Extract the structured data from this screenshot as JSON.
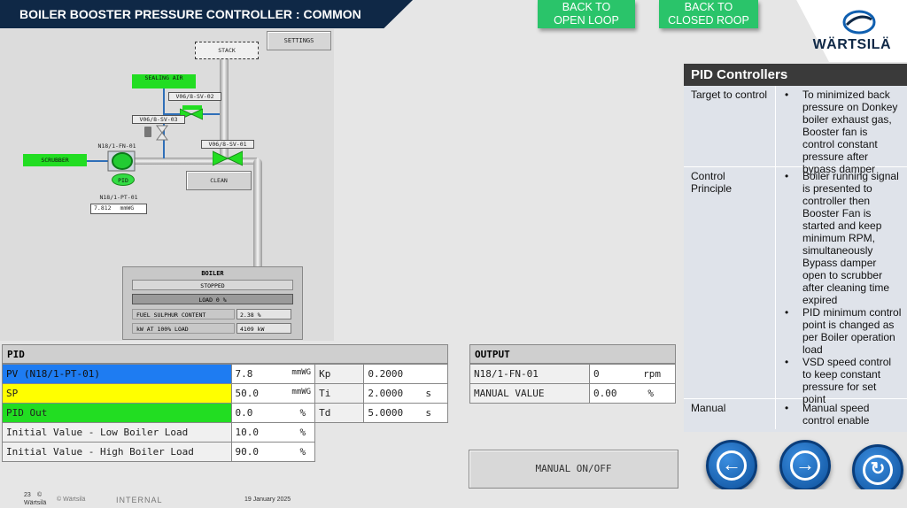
{
  "header": {
    "title": "BOILER BOOSTER PRESSURE CONTROLLER : COMMON",
    "back_open_loop": "BACK TO OPEN LOOP",
    "back_closed_loop": "BACK TO CLOSED ROOP",
    "logo": "WÄRTSILÄ"
  },
  "diagram": {
    "settings": "SETTINGS",
    "stack": "STACK",
    "sealing_air": "SEALING AIR",
    "valve_sv02": "V06/8-SV-02",
    "valve_sv03": "V06/8-SV-03",
    "valve_sv01": "V06/8-SV-01",
    "fan_tag": "N18/1-FN-01",
    "scrubber": "SCRUBBER",
    "pid": "PID",
    "clean": "CLEAN",
    "pt_tag": "N18/1-PT-01",
    "pt_value": "7.812",
    "pt_unit": "mmWG",
    "boiler": {
      "title": "BOILER",
      "status": "STOPPED",
      "load": "LOAD 0 %",
      "fuel_label": "FUEL SULPHUR CONTENT",
      "fuel_value": "2.38 %",
      "kw_label": "kW AT 100% LOAD",
      "kw_value": "4109 kW"
    }
  },
  "pid": {
    "title": "PID",
    "rows": [
      {
        "label": "PV (N18/1-PT-01)",
        "value": "7.8",
        "unit": "mmWG",
        "param": "Kp",
        "param_value": "0.2000",
        "param_unit": ""
      },
      {
        "label": "SP",
        "value": "50.0",
        "unit": "mmWG",
        "param": "Ti",
        "param_value": "2.0000",
        "param_unit": "s"
      },
      {
        "label": "PID Out",
        "value": "0.0",
        "unit": "%",
        "param": "Td",
        "param_value": "5.0000",
        "param_unit": "s"
      },
      {
        "label": "Initial Value - Low Boiler Load",
        "value": "10.0",
        "unit": "%"
      },
      {
        "label": "Initial Value - High Boiler Load",
        "value": "90.0",
        "unit": "%"
      }
    ]
  },
  "output": {
    "title": "OUTPUT",
    "rows": [
      {
        "label": "N18/1-FN-01",
        "value": "0",
        "unit": "rpm"
      },
      {
        "label": "MANUAL VALUE",
        "value": "0.00",
        "unit": "%"
      }
    ],
    "manual_button": "MANUAL ON/OFF"
  },
  "pid_controllers": {
    "title": "PID Controllers",
    "rows": [
      {
        "key": "Target to control",
        "items": [
          "To minimized back pressure on Donkey boiler exhaust gas, Booster fan is control constant pressure after bypass damper"
        ]
      },
      {
        "key": "Control Principle",
        "items": [
          "Boiler running signal is presented to controller then Booster Fan is started and keep minimum RPM, simultaneously Bypass damper open to scrubber after cleaning time expired",
          "PID minimum control point is changed as per Boiler operation load",
          "VSD speed control to keep constant pressure for set point"
        ]
      },
      {
        "key": "Manual",
        "items": [
          "Manual speed control enable"
        ]
      }
    ]
  },
  "footer": {
    "page": "23",
    "copyright": "©",
    "company": "Wärtsilä",
    "company2": "© Wärtsilä",
    "classification": "INTERNAL",
    "date": "19 January 2025"
  },
  "colors": {
    "pv": "#1e7cf2",
    "sp": "#ffff00",
    "out": "#22dd22",
    "navy": "#0f2846",
    "nav_btn": "#2cc66a"
  }
}
